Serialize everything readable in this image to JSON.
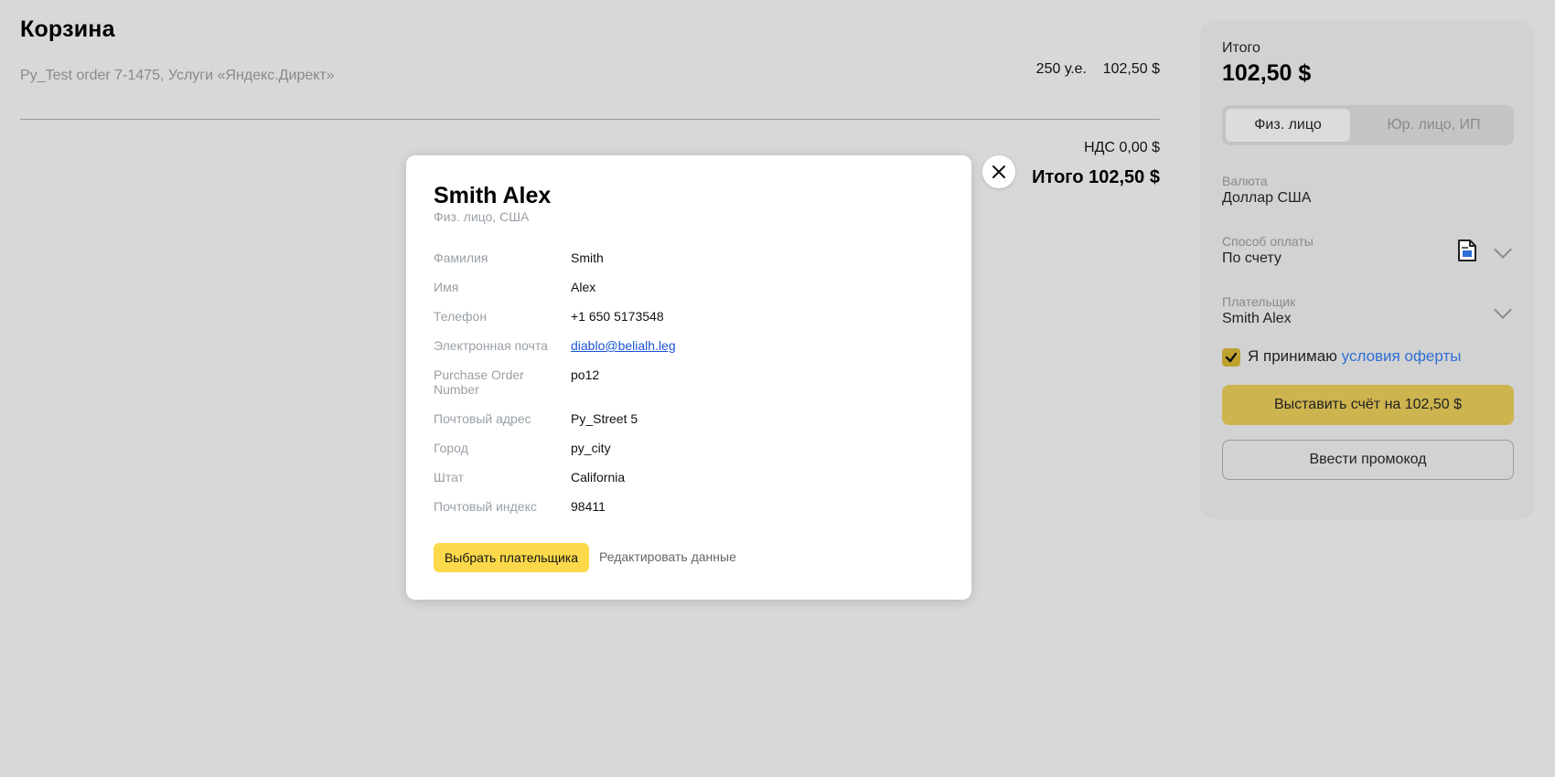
{
  "cart": {
    "title": "Корзина",
    "item_description": "Py_Test order 7-1475, Услуги «Яндекс.Директ»",
    "item_quantity": "250 у.е.",
    "item_price": "102,50 $",
    "vat": "НДС 0,00 $",
    "total": "Итого 102,50 $"
  },
  "summary": {
    "total_label": "Итого",
    "total_amount": "102,50 $",
    "tabs": [
      {
        "label": "Физ. лицо",
        "active": true
      },
      {
        "label": "Юр. лицо, ИП",
        "active": false
      }
    ],
    "currency": {
      "label": "Валюта",
      "value": "Доллар США"
    },
    "payment_method": {
      "label": "Способ оплаты",
      "value": "По счету",
      "icon": "invoice-document-icon"
    },
    "payer": {
      "label": "Плательщик",
      "value": "Smith Alex"
    },
    "accept": {
      "checked": true,
      "text": "Я принимаю ",
      "link_text": "условия оферты"
    },
    "invoice_button": "Выставить счёт на 102,50 $",
    "promo_button": "Ввести промокод",
    "colors": {
      "accent": "#cdb44f",
      "link": "#2f6fd6"
    }
  },
  "modal": {
    "title": "Smith Alex",
    "subtitle": "Физ. лицо, США",
    "fields": [
      {
        "label": "Фамилия",
        "value": "Smith"
      },
      {
        "label": "Имя",
        "value": "Alex"
      },
      {
        "label": "Телефон",
        "value": "+1 650 5173548"
      },
      {
        "label": "Электронная почта",
        "value": "diablo@belialh.leg"
      },
      {
        "label": "Purchase Order Number",
        "value": "po12"
      },
      {
        "label": "Почтовый адрес",
        "value": "Py_Street 5"
      },
      {
        "label": "Город",
        "value": "py_city"
      },
      {
        "label": "Штат",
        "value": "California"
      },
      {
        "label": "Почтовый индекс",
        "value": "98411"
      }
    ],
    "choose_button": "Выбрать плательщика",
    "edit_link": "Редактировать данные",
    "close_icon": "close-icon",
    "colors": {
      "choose_button": "#fcd94a"
    }
  }
}
